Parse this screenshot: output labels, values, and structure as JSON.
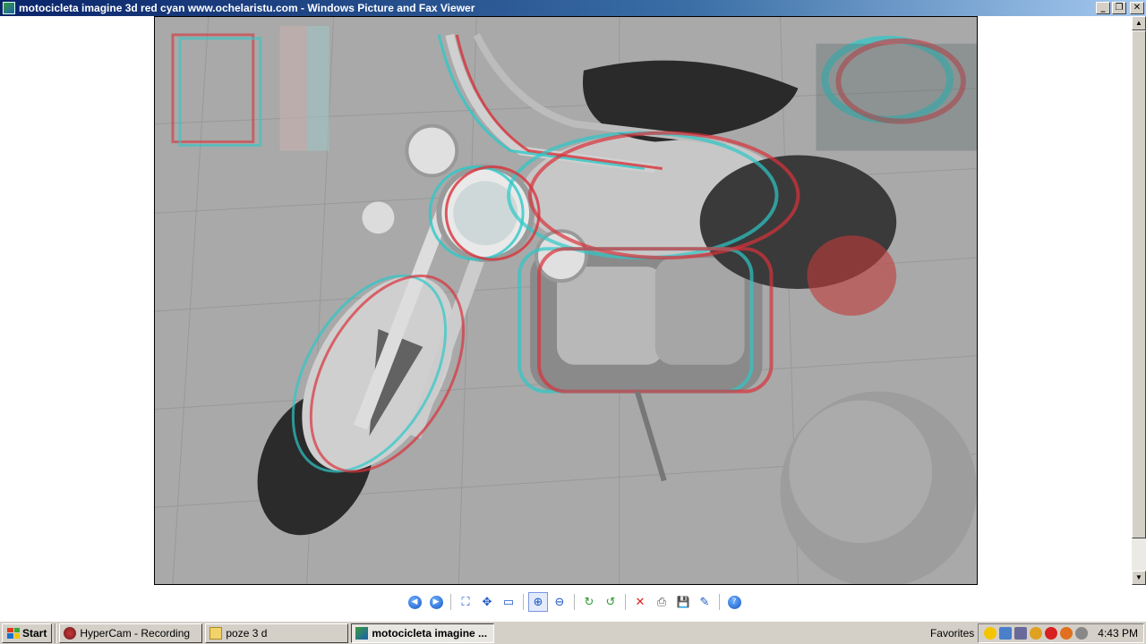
{
  "window": {
    "title": "motocicleta imagine 3d red cyan www.ochelaristu.com - Windows Picture and Fax Viewer",
    "minimize": "_",
    "restore": "❐",
    "close": "✕"
  },
  "image": {
    "description_icon": "photo"
  },
  "toolbar": {
    "buttons": [
      {
        "name": "previous-image-button",
        "glyph": "◀"
      },
      {
        "name": "next-image-button",
        "glyph": "▶"
      },
      {
        "name": "best-fit-button",
        "glyph": "⛶"
      },
      {
        "name": "actual-size-button",
        "glyph": "✥"
      },
      {
        "name": "slideshow-button",
        "glyph": "▭"
      },
      {
        "name": "zoom-in-button",
        "glyph": "⊕"
      },
      {
        "name": "zoom-out-button",
        "glyph": "⊖"
      },
      {
        "name": "rotate-clockwise-button",
        "glyph": "↻"
      },
      {
        "name": "rotate-counterclockwise-button",
        "glyph": "↺"
      },
      {
        "name": "delete-button",
        "glyph": "✕"
      },
      {
        "name": "print-button",
        "glyph": "⎙"
      },
      {
        "name": "save-button",
        "glyph": "💾"
      },
      {
        "name": "edit-button",
        "glyph": "✎"
      },
      {
        "name": "help-button",
        "glyph": "?"
      }
    ]
  },
  "taskbar": {
    "start_label": "Start",
    "tasks": [
      {
        "label": "HyperCam - Recording",
        "active": false
      },
      {
        "label": "poze 3 d",
        "active": false
      },
      {
        "label": "motocicleta imagine ...",
        "active": true
      }
    ],
    "favorites_label": "Favorites",
    "clock": "4:43 PM"
  },
  "colors": {
    "titlebar_start": "#0a246a",
    "titlebar_end": "#a6caf0",
    "anaglyph_red": "#d8323a",
    "anaglyph_cyan": "#2ec8c8"
  }
}
